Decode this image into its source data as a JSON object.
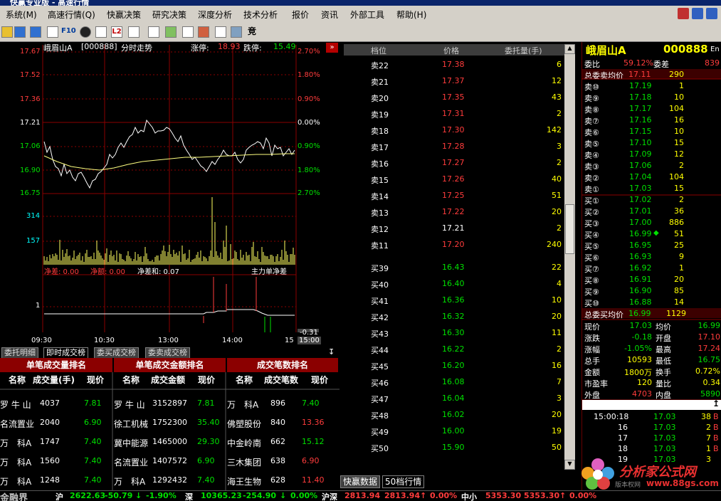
{
  "window": {
    "title": "快赢专业版 - 高速行情"
  },
  "menu": [
    "系统(M)",
    "高速行情(Q)",
    "快赢决策",
    "研究决策",
    "深度分析",
    "技术分析",
    "报价",
    "资讯",
    "外部工具",
    "帮助(H)"
  ],
  "toolbar": {
    "f10": "F10",
    "l2": "L2",
    "jing": "竞"
  },
  "chart": {
    "stock_name": "峨眉山A",
    "code": "[000888]",
    "mode": "分时走势",
    "limit_up_label": "涨停:",
    "limit_up": "18.93",
    "limit_down_label": "跌停:",
    "limit_down": "15.49",
    "expand": "»",
    "price_labels": [
      "17.67",
      "17.52",
      "17.36",
      "17.21",
      "17.06",
      "16.90",
      "16.75"
    ],
    "pct_labels": [
      "2.70%",
      "1.80%",
      "0.90%",
      "0.00%",
      "0.90%",
      "1.80%",
      "2.70%"
    ],
    "vol_labels": [
      "314",
      "157"
    ],
    "sub_legend": {
      "a": "净差: 0.00",
      "b": "净额: 0.00",
      "c": "净差和: 0.07",
      "d": "主力单净差"
    },
    "sub_label": "1",
    "sub_value": "-0.31",
    "time_labels": [
      "09:30",
      "10:30",
      "13:00",
      "14:00",
      "15",
      "15:00"
    ]
  },
  "left_tabs": [
    "委托明细",
    "即时成交榜",
    "委买成交榜",
    "委卖成交榜"
  ],
  "rank": {
    "sections": [
      {
        "title": "单笔成交量排名",
        "headers": [
          "名称",
          "成交量(手)",
          "现价"
        ],
        "rows": [
          [
            "罗 牛 山",
            "4037",
            "7.81"
          ],
          [
            "名流置业",
            "2040",
            "6.90"
          ],
          [
            "万　科A",
            "1747",
            "7.40"
          ],
          [
            "万　科A",
            "1560",
            "7.40"
          ],
          [
            "万　科A",
            "1248",
            "7.40"
          ]
        ]
      },
      {
        "title": "单笔成交金额排名",
        "headers": [
          "名称",
          "成交金额",
          "现价"
        ],
        "rows": [
          [
            "罗 牛 山",
            "3152897",
            "7.81"
          ],
          [
            "徐工机械",
            "1752300",
            "35.40"
          ],
          [
            "冀中能源",
            "1465000",
            "29.30"
          ],
          [
            "名流置业",
            "1407572",
            "6.90"
          ],
          [
            "万　科A",
            "1292432",
            "7.40"
          ]
        ]
      },
      {
        "title": "成交笔数排名",
        "headers": [
          "名称",
          "成交笔数",
          "现价"
        ],
        "rows": [
          [
            "万　科A",
            "896",
            "7.40"
          ],
          [
            "佛塑股份",
            "840",
            "13.36"
          ],
          [
            "中金岭南",
            "662",
            "15.12"
          ],
          [
            "三木集团",
            "638",
            "6.90"
          ],
          [
            "海王生物",
            "628",
            "11.40"
          ]
        ]
      }
    ]
  },
  "book": {
    "headers": [
      "档位",
      "价格",
      "委托量(手)"
    ],
    "sells": [
      [
        "卖22",
        "17.38",
        "6"
      ],
      [
        "卖21",
        "17.37",
        "12"
      ],
      [
        "卖20",
        "17.35",
        "43"
      ],
      [
        "卖19",
        "17.31",
        "2"
      ],
      [
        "卖18",
        "17.30",
        "142"
      ],
      [
        "卖17",
        "17.28",
        "3"
      ],
      [
        "卖16",
        "17.27",
        "2"
      ],
      [
        "卖15",
        "17.26",
        "40"
      ],
      [
        "卖14",
        "17.25",
        "51"
      ],
      [
        "卖13",
        "17.22",
        "20"
      ],
      [
        "卖12",
        "17.21",
        "2"
      ],
      [
        "卖11",
        "17.20",
        "240"
      ]
    ],
    "buys": [
      [
        "买39",
        "16.43",
        "22"
      ],
      [
        "买40",
        "16.40",
        "4"
      ],
      [
        "买41",
        "16.36",
        "10"
      ],
      [
        "买42",
        "16.32",
        "20"
      ],
      [
        "买43",
        "16.30",
        "11"
      ],
      [
        "买44",
        "16.22",
        "2"
      ],
      [
        "买45",
        "16.20",
        "16"
      ],
      [
        "买46",
        "16.08",
        "7"
      ],
      [
        "买47",
        "16.04",
        "3"
      ],
      [
        "买48",
        "16.02",
        "20"
      ],
      [
        "买49",
        "16.00",
        "19"
      ],
      [
        "买50",
        "15.90",
        "50"
      ]
    ],
    "tabs": [
      "快赢数据",
      "50档行情"
    ]
  },
  "quote": {
    "name": "峨眉山A",
    "code": "000888",
    "lang": "En",
    "ratio_label": "委比",
    "ratio": "59.12%",
    "diff_label": "委差",
    "diff": "839",
    "sell_avg_label": "总委卖均价",
    "sell_avg": "17.11",
    "sell_avg_vol": "290",
    "sells": [
      [
        "卖⑩",
        "17.19",
        "1"
      ],
      [
        "卖⑨",
        "17.18",
        "10"
      ],
      [
        "卖⑧",
        "17.17",
        "104"
      ],
      [
        "卖⑦",
        "17.16",
        "16"
      ],
      [
        "卖⑥",
        "17.15",
        "10"
      ],
      [
        "卖⑤",
        "17.10",
        "15"
      ],
      [
        "卖④",
        "17.09",
        "12"
      ],
      [
        "卖③",
        "17.06",
        "2"
      ],
      [
        "卖②",
        "17.04",
        "104"
      ],
      [
        "卖①",
        "17.03",
        "15"
      ]
    ],
    "buys": [
      [
        "买①",
        "17.02",
        "2"
      ],
      [
        "买②",
        "17.01",
        "36"
      ],
      [
        "买③",
        "17.00",
        "886"
      ],
      [
        "买④",
        "16.99",
        "51"
      ],
      [
        "买⑤",
        "16.95",
        "25"
      ],
      [
        "买⑥",
        "16.93",
        "9"
      ],
      [
        "买⑦",
        "16.92",
        "1"
      ],
      [
        "买⑧",
        "16.91",
        "20"
      ],
      [
        "买⑨",
        "16.90",
        "85"
      ],
      [
        "买⑩",
        "16.88",
        "14"
      ]
    ],
    "buy_avg_label": "总委买均价",
    "buy_avg": "16.99",
    "buy_avg_vol": "1129",
    "stats": [
      [
        "现价",
        "17.03",
        "均价",
        "16.99"
      ],
      [
        "涨跌",
        "-0.18",
        "开盘",
        "17.10"
      ],
      [
        "涨幅",
        "-1.05%",
        "最高",
        "17.24"
      ],
      [
        "总手",
        "10593",
        "最低",
        "16.75"
      ],
      [
        "金额",
        "1800万",
        "换手",
        "0.72%"
      ],
      [
        "市盈率",
        "120",
        "量比",
        "0.34"
      ],
      [
        "外盘",
        "4703",
        "内盘",
        "5890"
      ]
    ],
    "ticks": [
      [
        "15:00:18",
        "17.03",
        "38",
        "B"
      ],
      [
        "16",
        "17.03",
        "2",
        "B"
      ],
      [
        "17",
        "17.03",
        "7",
        "B"
      ],
      [
        "18",
        "17.03",
        "1",
        "B"
      ],
      [
        "19",
        "17.03",
        "3",
        ""
      ]
    ]
  },
  "status": {
    "logo": "金融界",
    "sh_label": "沪",
    "sh": "2622.63",
    "sh_chg": "-50.79",
    "sh_pct": "-1.90%",
    "sz_label": "深",
    "sz": "10365.23",
    "sz_chg": "-254.90",
    "sz_pct": "0.00%",
    "hs_label": "沪深",
    "hs": "2813.94",
    "hs2": "2813.94",
    "hs_pct": "0.00%",
    "zx_label": "中小",
    "zx": "5353.30",
    "zx2": "5353.30",
    "zx_pct": "0.00%"
  },
  "watermark": {
    "text": "分析家公式网",
    "sub": "www.88gs.com",
    "small": "版本权网"
  },
  "colors": {
    "up": "#ff3c3c",
    "down": "#00e000",
    "yellow": "#ffff00",
    "grid": "#8b0000",
    "cyan": "#00ffff"
  }
}
